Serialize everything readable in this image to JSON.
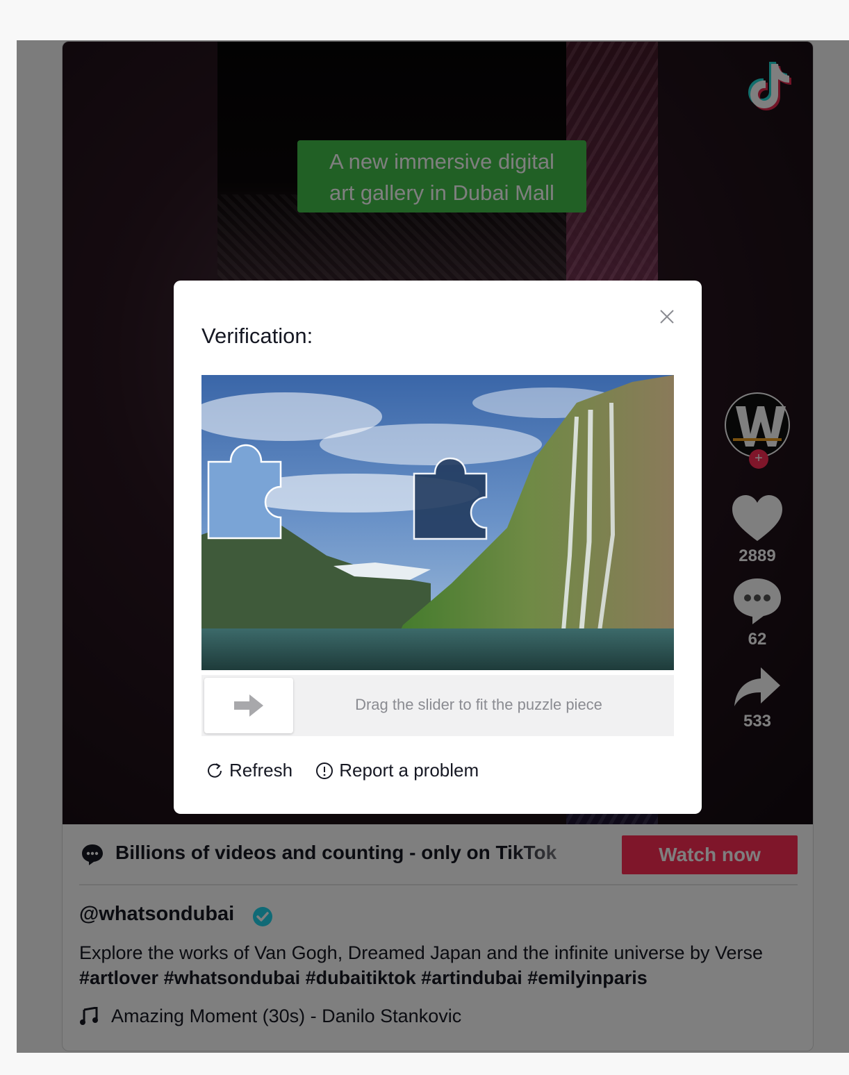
{
  "video": {
    "caption_line1": "A new immersive digital",
    "caption_line2": "art gallery in Dubai Mall",
    "likes": "2889",
    "comments": "62",
    "shares": "533"
  },
  "promo": {
    "text": "Billions of videos and counting - only on TikTok",
    "watch_label": "Watch now",
    "accent": "#fe2c55"
  },
  "post": {
    "author": "@whatsondubai",
    "description": "Explore the works of Van Gogh, Dreamed Japan and the infinite universe by Verse",
    "hashtags": [
      "#artlover",
      "#whatsondubai",
      "#dubaitiktok",
      "#artindubai",
      "#emilyinparis"
    ],
    "music": "Amazing Moment (30s) - Danilo Stankovic"
  },
  "captcha": {
    "title": "Verification:",
    "slider_hint": "Drag the slider to fit the puzzle piece",
    "refresh_label": "Refresh",
    "report_label": "Report a problem"
  },
  "icons": {
    "logo": "tiktok-logo-icon",
    "like": "heart-icon",
    "comment": "comment-bubble-icon",
    "share": "share-arrow-icon",
    "close": "close-icon",
    "refresh": "refresh-icon",
    "report": "exclamation-circle-icon",
    "music": "music-note-icon",
    "verified": "verified-check-icon",
    "slider": "arrow-right-icon"
  }
}
